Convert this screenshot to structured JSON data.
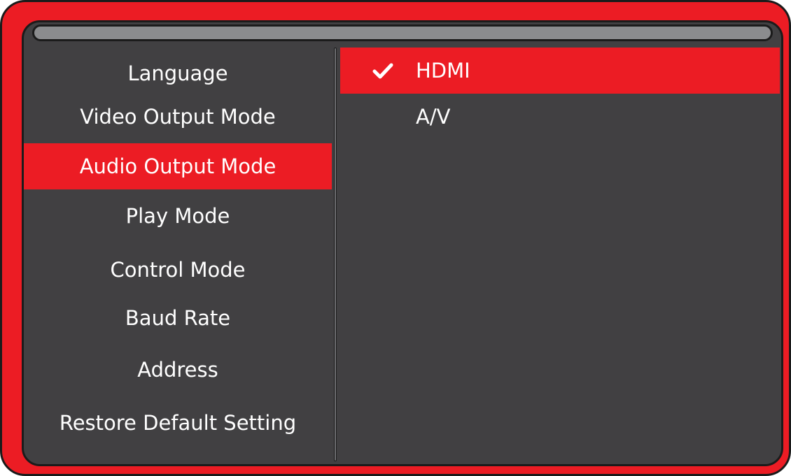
{
  "menu": {
    "items": [
      {
        "label": "Language",
        "selected": false
      },
      {
        "label": "Video Output Mode",
        "selected": false
      },
      {
        "label": "Audio Output Mode",
        "selected": true
      },
      {
        "label": "Play Mode",
        "selected": false
      },
      {
        "label": "Control Mode",
        "selected": false
      },
      {
        "label": "Baud Rate",
        "selected": false
      },
      {
        "label": "Address",
        "selected": false
      },
      {
        "label": "Restore Default Setting",
        "selected": false
      }
    ]
  },
  "options": {
    "items": [
      {
        "label": "HDMI",
        "checked": true,
        "icon": "checkmark-icon"
      },
      {
        "label": "A/V",
        "checked": false
      }
    ]
  },
  "colors": {
    "accent": "#ec1c24",
    "panel": "#414042",
    "titlebar": "#8b8c8e",
    "text": "#ffffff"
  }
}
